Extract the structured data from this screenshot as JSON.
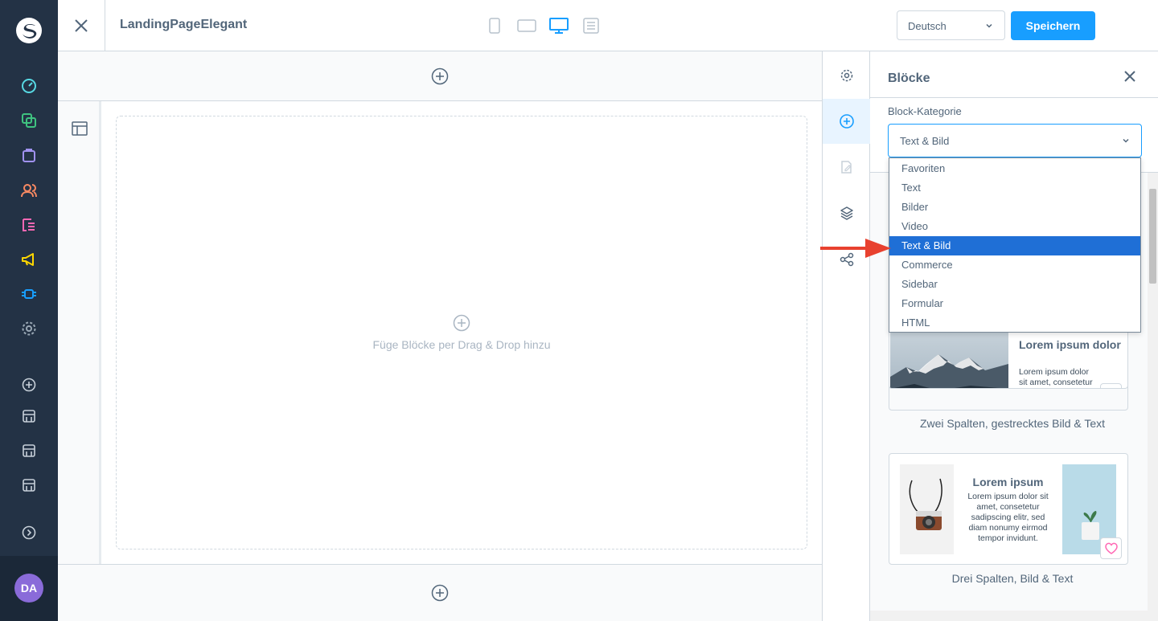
{
  "topbar": {
    "title": "LandingPageElegant",
    "language": "Deutsch",
    "save_label": "Speichern"
  },
  "appbar": {
    "avatar_initials": "DA",
    "icons": [
      "dashboard-icon",
      "catalogue-icon",
      "orders-icon",
      "customers-icon",
      "content-icon",
      "marketing-icon",
      "extensions-icon",
      "settings-icon",
      "add-icon",
      "sales-channel-icon",
      "sales-channel-icon",
      "sales-channel-icon",
      "expand-icon"
    ]
  },
  "canvas": {
    "drop_hint": "Füge Blöcke per Drag & Drop hinzu"
  },
  "panel": {
    "title": "Blöcke",
    "category_label": "Block-Kategorie",
    "category_value": "Text & Bild",
    "options": [
      "Favoriten",
      "Text",
      "Bilder",
      "Video",
      "Text & Bild",
      "Commerce",
      "Sidebar",
      "Formular",
      "HTML"
    ],
    "selected_index": 4
  },
  "blocks": [
    {
      "name": "Zwei Spalten, gestrecktes Bild & Text",
      "heading": "Lorem ipsum dolor",
      "text": "Lorem ipsum dolor sit amet, consetetur sadipscing elitr."
    },
    {
      "name": "Drei Spalten, Bild & Text",
      "heading": "Lorem ipsum",
      "text": "Lorem ipsum dolor sit amet, consetetur sadipscing elitr, sed diam nonumy eirmod tempor invidunt."
    }
  ],
  "colors": {
    "accent": "#189eff",
    "sidebar": "#233245",
    "selected_option": "#1f6fd6",
    "annotation_arrow": "#e8412f"
  }
}
